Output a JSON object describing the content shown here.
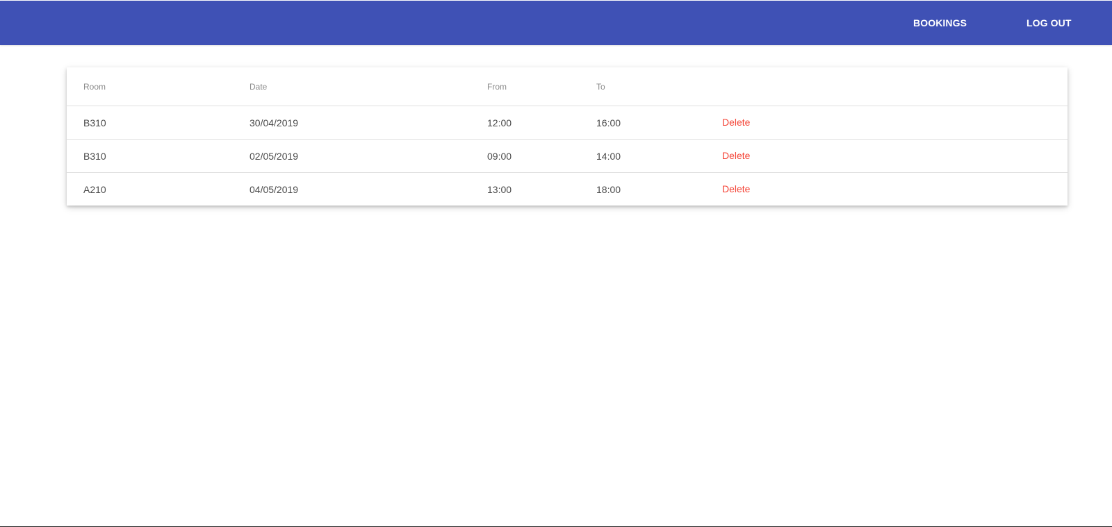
{
  "colors": {
    "toolbar": "#3f51b5",
    "toolbar_text": "#ffffff",
    "delete": "#f44336",
    "header_text": "#8a8a8a",
    "cell_text": "#4a4a4a"
  },
  "toolbar": {
    "bookings_label": "BOOKINGS",
    "logout_label": "LOG OUT"
  },
  "table": {
    "headers": {
      "room": "Room",
      "date": "Date",
      "from": "From",
      "to": "To"
    },
    "rows": [
      {
        "room": "B310",
        "date": "30/04/2019",
        "from": "12:00",
        "to": "16:00",
        "action": "Delete"
      },
      {
        "room": "B310",
        "date": "02/05/2019",
        "from": "09:00",
        "to": "14:00",
        "action": "Delete"
      },
      {
        "room": "A210",
        "date": "04/05/2019",
        "from": "13:00",
        "to": "18:00",
        "action": "Delete"
      }
    ]
  }
}
